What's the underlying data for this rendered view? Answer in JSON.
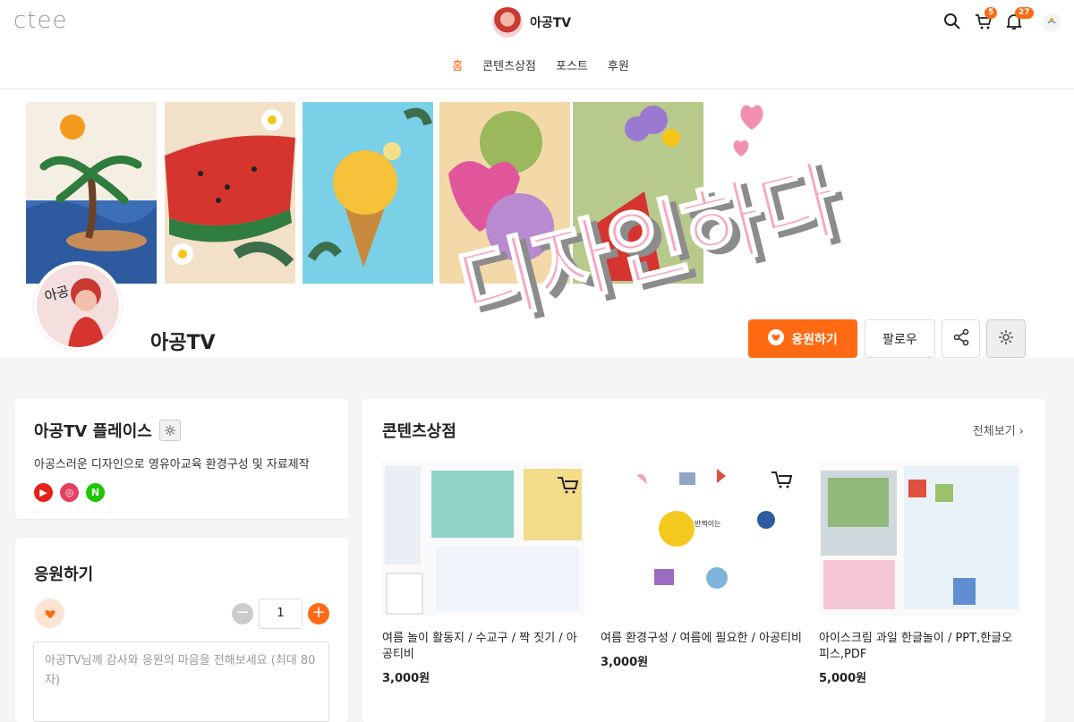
{
  "header": {
    "logo": "ctee",
    "creator_name": "아공TV",
    "cart_count": "5",
    "notif_count": "27",
    "menu": [
      "홈",
      "콘텐츠상점",
      "포스트",
      "후원"
    ]
  },
  "banner": {
    "text": "디자인하다"
  },
  "profile": {
    "name": "아공TV",
    "avatar_text": "아공",
    "support_label": "응원하기",
    "follow_label": "팔로우"
  },
  "place": {
    "title": "아공TV 플레이스",
    "description": "아공스러운 디자인으로 영유아교육 환경구성 및 자료제작",
    "socials": [
      {
        "name": "youtube",
        "glyph": "▶",
        "color": "#e62117"
      },
      {
        "name": "instagram",
        "glyph": "◎",
        "color": "#e4405f"
      },
      {
        "name": "naver",
        "glyph": "N",
        "color": "#1ec800"
      }
    ]
  },
  "support": {
    "title": "응원하기",
    "quantity": "1",
    "message_placeholder": "아공TV님께 감사와 응원의 마음을 전해보세요 (최대 80자)"
  },
  "store": {
    "title": "콘텐츠상점",
    "view_all": "전체보기 ›",
    "products": [
      {
        "title": "여름 놀이 활동지 / 수교구 / 짝 짓기 / 아공티비",
        "price": "3,000원"
      },
      {
        "title": "여름 환경구성 / 여름에 필요한 / 아공티비",
        "price": "3,000원"
      },
      {
        "title": "아이스크림 과일 한글놀이 / PPT,한글오피스,PDF",
        "price": "5,000원"
      }
    ]
  },
  "colors": {
    "accent": "#ff6a13"
  }
}
